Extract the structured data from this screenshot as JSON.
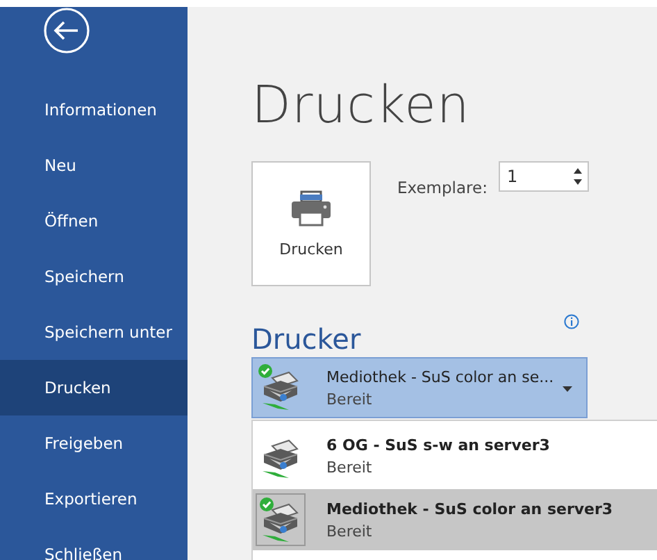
{
  "sidebar": {
    "items": [
      {
        "label": "Informationen",
        "selected": false
      },
      {
        "label": "Neu",
        "selected": false
      },
      {
        "label": "Öffnen",
        "selected": false
      },
      {
        "label": "Speichern",
        "selected": false
      },
      {
        "label": "Speichern unter",
        "selected": false
      },
      {
        "label": "Drucken",
        "selected": true
      },
      {
        "label": "Freigeben",
        "selected": false
      },
      {
        "label": "Exportieren",
        "selected": false
      },
      {
        "label": "Schließen",
        "selected": false
      }
    ]
  },
  "title": "Drucken",
  "print_button": {
    "label": "Drucken"
  },
  "copies": {
    "label": "Exemplare:",
    "value": "1"
  },
  "printer_section": {
    "heading": "Drucker",
    "dropdown": {
      "name": "Mediothek - SuS color an se...",
      "status": "Bereit",
      "default": true,
      "expanded": true
    },
    "options": [
      {
        "name": "6 OG - SuS s-w an server3",
        "status": "Bereit",
        "default": false,
        "selected": false
      },
      {
        "name": "Mediothek - SuS color an server3",
        "status": "Bereit",
        "default": true,
        "selected": true
      }
    ]
  }
}
